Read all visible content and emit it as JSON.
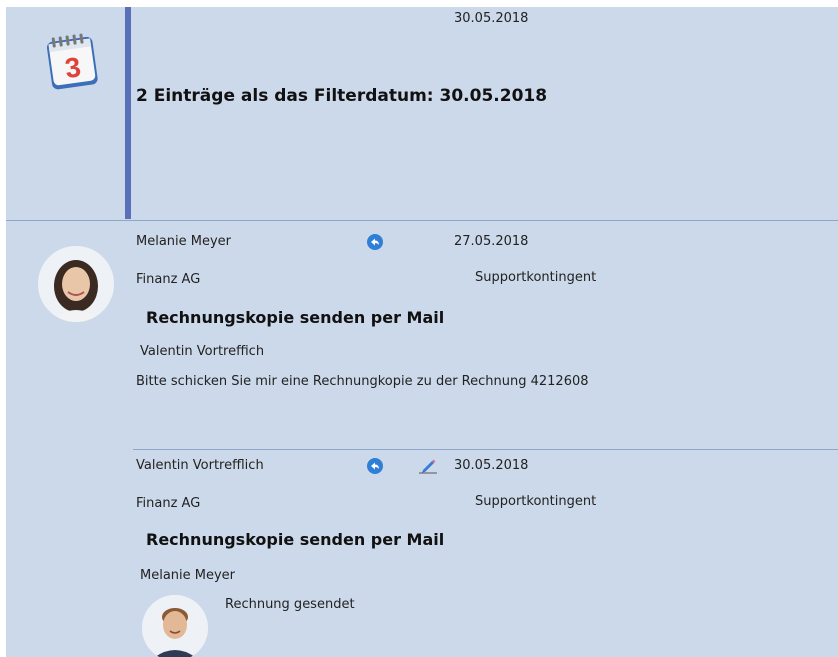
{
  "header": {
    "date": "30.05.2018",
    "title": "2 Einträge als das Filterdatum: 30.05.2018",
    "calendar_day": "3"
  },
  "entries": [
    {
      "author": "Melanie Meyer",
      "date": "27.05.2018",
      "company": "Finanz AG",
      "category": "Supportkontingent",
      "subject": "Rechnungskopie senden per Mail",
      "recipient": "Valentin Vortreffich",
      "body": "Bitte schicken Sie mir eine Rechnungkopie zu der Rechnung 4212608"
    },
    {
      "author": "Valentin Vortrefflich",
      "date": "30.05.2018",
      "company": "Finanz AG",
      "category": "Supportkontingent",
      "subject": "Rechnungskopie senden per Mail",
      "recipient": "Melanie Meyer",
      "body": "Rechnung gesendet"
    }
  ],
  "colors": {
    "panel_bg": "#ccd9ea",
    "accent_bar": "#5b6fb8",
    "reply_icon": "#2f7fd6"
  }
}
